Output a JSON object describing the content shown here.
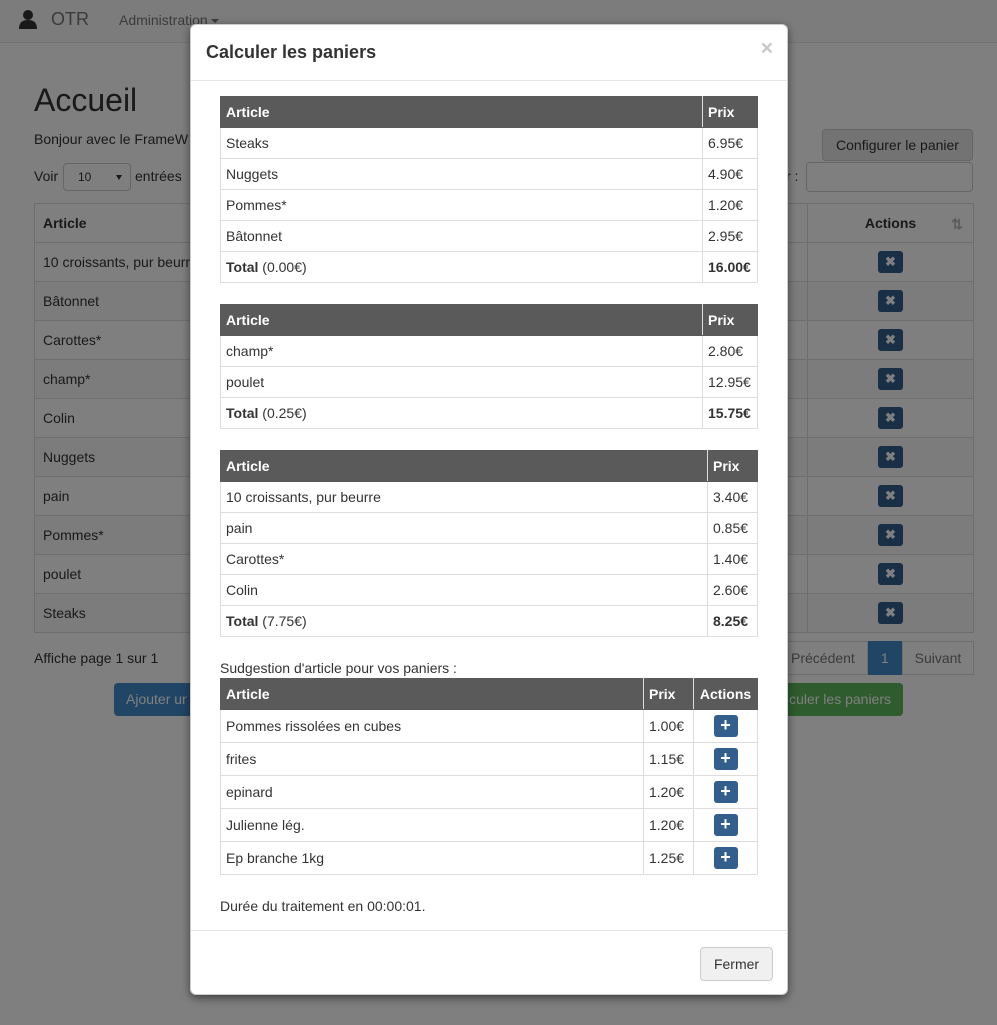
{
  "navbar": {
    "brand": "OTR",
    "admin": "Administration"
  },
  "page": {
    "title": "Accueil",
    "intro": "Bonjour avec le FrameW",
    "config_button": "Configurer le panier",
    "length_before": "Voir",
    "length_value": "10",
    "length_after": "entrées",
    "search_label": "r :",
    "table": {
      "col_article": "Article",
      "col_actions": "Actions",
      "rows": [
        "10 croissants, pur beurr",
        "Bâtonnet",
        "Carottes*",
        "champ*",
        "Colin",
        "Nuggets",
        "pain",
        "Pommes*",
        "poulet",
        "Steaks"
      ]
    },
    "page_info": "Affiche page 1 sur 1",
    "pager": {
      "prev": "Précédent",
      "current": "1",
      "next": "Suivant"
    },
    "add_button": "Ajouter ur",
    "calc_button": "culer les paniers"
  },
  "modal": {
    "title": "Calculer les paniers",
    "close_symbol": "×",
    "col_article": "Article",
    "col_prix": "Prix",
    "col_actions": "Actions",
    "total_label": "Total",
    "baskets": [
      {
        "items": [
          {
            "name": "Steaks",
            "price": "6.95€"
          },
          {
            "name": "Nuggets",
            "price": "4.90€"
          },
          {
            "name": "Pommes*",
            "price": "1.20€"
          },
          {
            "name": "Bâtonnet",
            "price": "2.95€"
          }
        ],
        "total_paren": "(0.00€)",
        "total": "16.00€"
      },
      {
        "items": [
          {
            "name": "champ*",
            "price": "2.80€"
          },
          {
            "name": "poulet",
            "price": "12.95€"
          }
        ],
        "total_paren": "(0.25€)",
        "total": "15.75€"
      },
      {
        "items": [
          {
            "name": "10 croissants, pur beurre",
            "price": "3.40€"
          },
          {
            "name": "pain",
            "price": "0.85€"
          },
          {
            "name": "Carottes*",
            "price": "1.40€"
          },
          {
            "name": "Colin",
            "price": "2.60€"
          }
        ],
        "total_paren": "(7.75€)",
        "total": "8.25€"
      }
    ],
    "suggestion_label": "Sudgestion d'article pour vos paniers :",
    "suggestions": [
      {
        "name": "Pommes rissolées en cubes",
        "price": "1.00€"
      },
      {
        "name": "frites",
        "price": "1.15€"
      },
      {
        "name": "epinard",
        "price": "1.20€"
      },
      {
        "name": "Julienne lég.",
        "price": "1.20€"
      },
      {
        "name": "Ep branche 1kg",
        "price": "1.25€"
      }
    ],
    "duration": "Durée du traitement en 00:00:01.",
    "close_button": "Fermer"
  }
}
